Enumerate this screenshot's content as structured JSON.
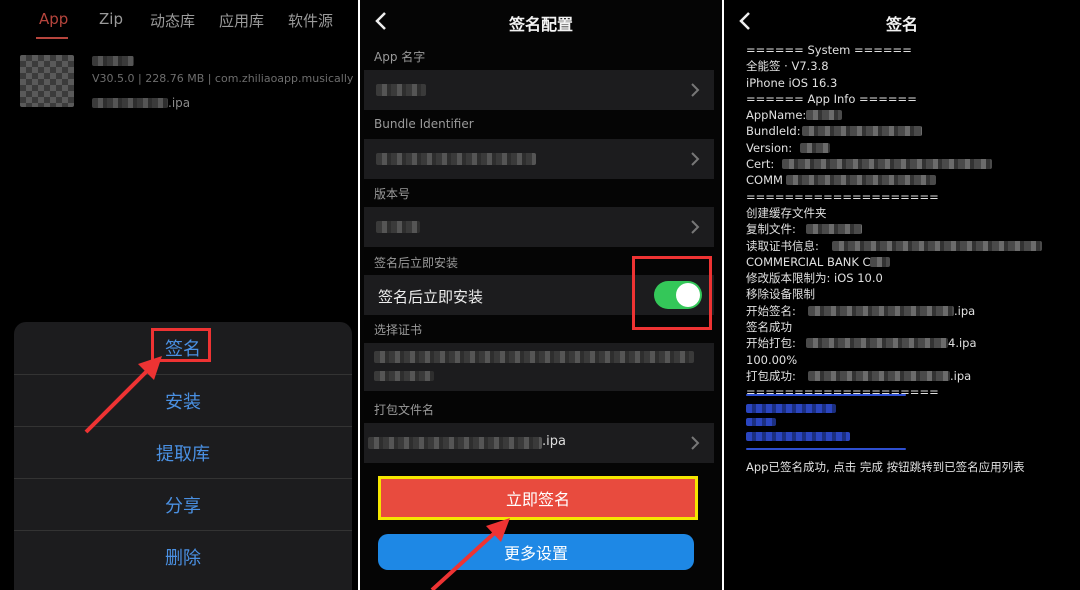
{
  "left": {
    "tabs": [
      "App",
      "Zip",
      "动态库",
      "应用库",
      "软件源"
    ],
    "active_tab": "App",
    "app_item": {
      "meta": "V30.5.0 | 228.76 MB | com.zhiliaoapp.musically",
      "file_ext": ".ipa"
    },
    "action_sheet": [
      "签名",
      "安装",
      "提取库",
      "分享",
      "删除"
    ]
  },
  "middle": {
    "title": "签名配置",
    "sections": {
      "app_name": "App 名字",
      "bundle_id": "Bundle Identifier",
      "version": "版本号",
      "install_after": "签名后立即安装",
      "certificate": "选择证书",
      "package_name": "打包文件名"
    },
    "toggle_label": "签名后立即安装",
    "toggle_on": true,
    "package_ext": ".ipa",
    "sign_now_button": "立即签名",
    "more_settings_button": "更多设置"
  },
  "right": {
    "title": "签名",
    "log": [
      "====== System ======",
      "全能签 · V7.3.8",
      "iPhone iOS 16.3",
      "====== App Info ======",
      "AppName:",
      "BundleId:",
      "Version:",
      "Cert:",
      "COMM",
      "====================",
      "创建缓存文件夹",
      "复制文件:",
      "读取证书信息:",
      "COMMERCIAL BANK C",
      "修改版本限制为: iOS 10.0",
      "移除设备限制",
      "开始签名:",
      "签名成功",
      "开始打包:",
      "100.00%",
      "打包成功:",
      "===================="
    ],
    "ipa_suffixes": {
      "sign": ".ipa",
      "pack": "4.ipa",
      "done": ".ipa"
    },
    "final_message": "App已签名成功, 点击 完成 按钮跳转到已签名应用列表"
  },
  "colors": {
    "accent_red": "#b7453d",
    "link_blue": "#4a90e2",
    "toggle_green": "#34c759",
    "sign_button": "#e84b3e",
    "more_button": "#1e88e5",
    "highlight_red": "#ee3333",
    "highlight_yellow": "#f5e600"
  }
}
